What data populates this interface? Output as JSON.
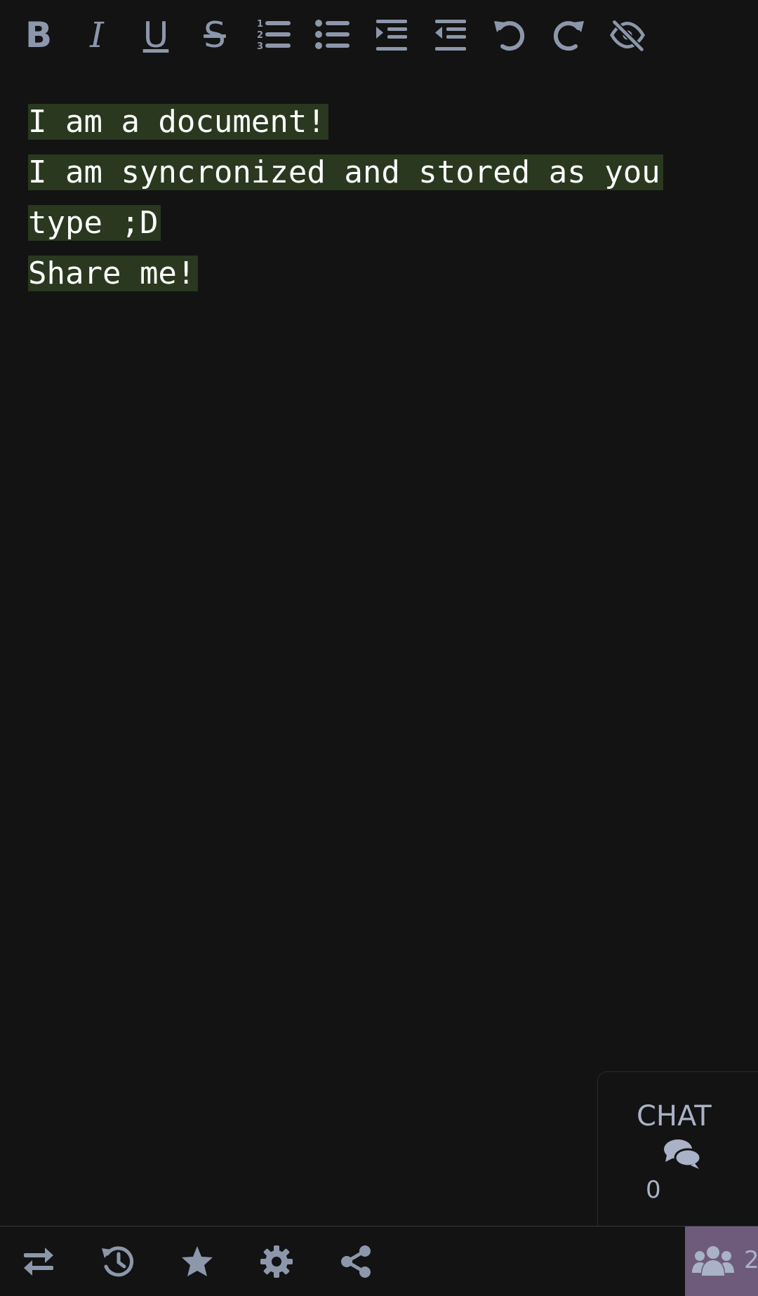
{
  "toolbar": {
    "bold_letter": "B",
    "italic_letter": "I",
    "underline_letter": "U",
    "strike_letter": "S",
    "icon_color": "#8d97ab"
  },
  "editor": {
    "lines": [
      "I am a document!",
      "I am syncronized and stored as you",
      "type ;D",
      "Share me!"
    ],
    "highlight_color": "#29381f"
  },
  "chat": {
    "title": "CHAT",
    "count": "0"
  },
  "bottombar": {
    "users_count": "2",
    "users_bg": "#6e5b7c"
  }
}
